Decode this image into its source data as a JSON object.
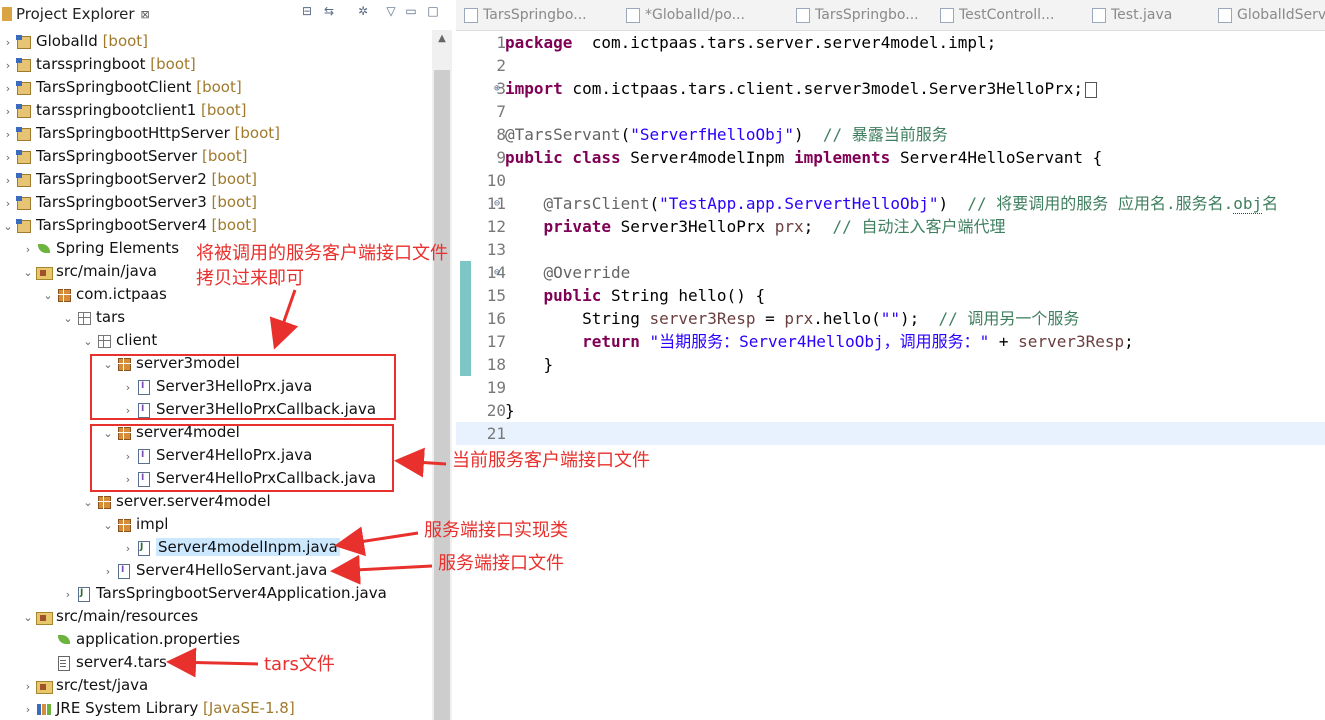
{
  "explorer": {
    "title": "Project Explorer",
    "close_glyph": "⊠",
    "tree": [
      {
        "level": 0,
        "twisty": ">",
        "icon": "project-icon",
        "label": "GlobalId",
        "meta": "[boot]"
      },
      {
        "level": 0,
        "twisty": ">",
        "icon": "project-icon",
        "label": "tarsspringboot",
        "meta": "[boot]"
      },
      {
        "level": 0,
        "twisty": ">",
        "icon": "project-icon",
        "label": "TarsSpringbootClient",
        "meta": "[boot]"
      },
      {
        "level": 0,
        "twisty": ">",
        "icon": "project-icon",
        "label": "tarsspringbootclient1",
        "meta": "[boot]"
      },
      {
        "level": 0,
        "twisty": ">",
        "icon": "project-icon",
        "label": "TarsSpringbootHttpServer",
        "meta": "[boot]"
      },
      {
        "level": 0,
        "twisty": ">",
        "icon": "project-icon",
        "label": "TarsSpringbootServer",
        "meta": "[boot]"
      },
      {
        "level": 0,
        "twisty": ">",
        "icon": "project-icon",
        "label": "TarsSpringbootServer2",
        "meta": "[boot]"
      },
      {
        "level": 0,
        "twisty": ">",
        "icon": "project-icon",
        "label": "TarsSpringbootServer3",
        "meta": "[boot]"
      },
      {
        "level": 0,
        "twisty": "v",
        "icon": "project-icon",
        "label": "TarsSpringbootServer4",
        "meta": "[boot]"
      },
      {
        "level": 1,
        "twisty": ">",
        "icon": "spring-leaf-icon",
        "label": "Spring Elements",
        "meta": ""
      },
      {
        "level": 1,
        "twisty": "v",
        "icon": "source-folder-icon",
        "label": "src/main/java",
        "meta": ""
      },
      {
        "level": 2,
        "twisty": "v",
        "icon": "package-icon",
        "label": "com.ictpaas",
        "meta": ""
      },
      {
        "level": 3,
        "twisty": "v",
        "icon": "package-empty-icon",
        "label": "tars",
        "meta": ""
      },
      {
        "level": 4,
        "twisty": "v",
        "icon": "package-empty-icon",
        "label": "client",
        "meta": ""
      },
      {
        "level": 5,
        "twisty": "v",
        "icon": "package-icon",
        "label": "server3model",
        "meta": ""
      },
      {
        "level": 6,
        "twisty": ">",
        "icon": "java-interface-icon",
        "label": "Server3HelloPrx.java",
        "meta": ""
      },
      {
        "level": 6,
        "twisty": ">",
        "icon": "java-interface-icon",
        "label": "Server3HelloPrxCallback.java",
        "meta": ""
      },
      {
        "level": 5,
        "twisty": "v",
        "icon": "package-icon",
        "label": "server4model",
        "meta": ""
      },
      {
        "level": 6,
        "twisty": ">",
        "icon": "java-interface-icon",
        "label": "Server4HelloPrx.java",
        "meta": ""
      },
      {
        "level": 6,
        "twisty": ">",
        "icon": "java-interface-icon",
        "label": "Server4HelloPrxCallback.java",
        "meta": ""
      },
      {
        "level": 4,
        "twisty": "v",
        "icon": "package-icon",
        "label": "server.server4model",
        "meta": ""
      },
      {
        "level": 5,
        "twisty": "v",
        "icon": "package-icon",
        "label": "impl",
        "meta": ""
      },
      {
        "level": 6,
        "twisty": ">",
        "icon": "java-class-icon",
        "label": "Server4modelInpm.java",
        "meta": "",
        "selected": true
      },
      {
        "level": 5,
        "twisty": ">",
        "icon": "java-interface-icon",
        "label": "Server4HelloServant.java",
        "meta": ""
      },
      {
        "level": 3,
        "twisty": ">",
        "icon": "java-class-icon",
        "label": "TarsSpringbootServer4Application.java",
        "meta": ""
      },
      {
        "level": 1,
        "twisty": "v",
        "icon": "source-folder-icon",
        "label": "src/main/resources",
        "meta": ""
      },
      {
        "level": 2,
        "twisty": "",
        "icon": "spring-leaf-icon",
        "label": "application.properties",
        "meta": ""
      },
      {
        "level": 2,
        "twisty": "",
        "icon": "text-file-icon",
        "label": "server4.tars",
        "meta": ""
      },
      {
        "level": 1,
        "twisty": ">",
        "icon": "source-folder-icon",
        "label": "src/test/java",
        "meta": ""
      },
      {
        "level": 1,
        "twisty": ">",
        "icon": "library-icon",
        "label": "JRE System Library",
        "meta": "[JavaSE-1.8]"
      }
    ]
  },
  "editor": {
    "tabs": [
      {
        "label": "TarsSpringbo..."
      },
      {
        "label": "*GlobalId/po..."
      },
      {
        "label": "TarsSpringbo..."
      },
      {
        "label": "TestControll..."
      },
      {
        "label": "Test.java"
      },
      {
        "label": "GlobalIdServ..."
      }
    ],
    "lines": [
      {
        "num": "1",
        "fold": "",
        "tokens": [
          [
            "kw",
            "package"
          ],
          [
            "",
            "  com.ictpaas.tars.server.server4model.impl;"
          ]
        ]
      },
      {
        "num": "2",
        "fold": "",
        "tokens": []
      },
      {
        "num": "3",
        "fold": "⊕",
        "tokens": [
          [
            "kw",
            "import"
          ],
          [
            "",
            " com.ictpaas.tars.client.server3model.Server3HelloPrx;"
          ],
          [
            "box",
            "□"
          ]
        ]
      },
      {
        "num": "7",
        "fold": "",
        "tokens": []
      },
      {
        "num": "8",
        "fold": "",
        "tokens": [
          [
            "ann",
            "@TarsServant"
          ],
          [
            "",
            "("
          ],
          [
            "str",
            "\"ServerfHelloObj\""
          ],
          [
            "",
            ")  "
          ],
          [
            "cmt",
            "// 暴露当前服务"
          ]
        ]
      },
      {
        "num": "9",
        "fold": "",
        "tokens": [
          [
            "kw",
            "public class"
          ],
          [
            "",
            " Server4modelInpm "
          ],
          [
            "kw",
            "implements"
          ],
          [
            "",
            " Server4HelloServant {"
          ]
        ]
      },
      {
        "num": "10",
        "fold": "",
        "tokens": []
      },
      {
        "num": "11",
        "fold": "⊖",
        "tokens": [
          [
            "",
            "    "
          ],
          [
            "ann",
            "@TarsClient"
          ],
          [
            "",
            "("
          ],
          [
            "str",
            "\"TestApp.app.ServertHelloObj\""
          ],
          [
            "",
            ")  "
          ],
          [
            "cmt",
            "// 将要调用的服务 应用名.服务名."
          ],
          [
            "cmtsq",
            "obj"
          ],
          [
            "cmt",
            "名"
          ]
        ]
      },
      {
        "num": "12",
        "fold": "",
        "tokens": [
          [
            "",
            "    "
          ],
          [
            "kw",
            "private"
          ],
          [
            "",
            " Server3HelloPrx "
          ],
          [
            "var",
            "prx"
          ],
          [
            "",
            ";  "
          ],
          [
            "cmt",
            "// 自动注入客户端代理"
          ]
        ]
      },
      {
        "num": "13",
        "fold": "",
        "tokens": []
      },
      {
        "num": "14",
        "fold": "⊖",
        "tokens": [
          [
            "",
            "    "
          ],
          [
            "ann",
            "@Override"
          ]
        ]
      },
      {
        "num": "15",
        "fold": "",
        "tokens": [
          [
            "",
            "    "
          ],
          [
            "kw",
            "public"
          ],
          [
            "",
            " String hello() {"
          ]
        ]
      },
      {
        "num": "16",
        "fold": "",
        "tokens": [
          [
            "",
            "        String "
          ],
          [
            "var",
            "server3Resp"
          ],
          [
            "",
            " = "
          ],
          [
            "var",
            "prx"
          ],
          [
            "",
            ".hello("
          ],
          [
            "str",
            "\"\""
          ],
          [
            "",
            ");  "
          ],
          [
            "cmt",
            "// 调用另一个服务"
          ]
        ]
      },
      {
        "num": "17",
        "fold": "",
        "tokens": [
          [
            "",
            "        "
          ],
          [
            "kw",
            "return"
          ],
          [
            "",
            " "
          ],
          [
            "str",
            "\"当期服务：Server4HelloObj，调用服务：\""
          ],
          [
            "",
            " + "
          ],
          [
            "var",
            "server3Resp"
          ],
          [
            "",
            ";"
          ]
        ]
      },
      {
        "num": "18",
        "fold": "",
        "tokens": [
          [
            "",
            "    }"
          ]
        ]
      },
      {
        "num": "19",
        "fold": "",
        "tokens": []
      },
      {
        "num": "20",
        "fold": "",
        "tokens": [
          [
            "",
            "}"
          ]
        ]
      },
      {
        "num": "21",
        "fold": "",
        "tokens": []
      }
    ]
  },
  "annotations": {
    "copy_note_line1": "将被调用的服务客户端接口文件",
    "copy_note_line2": "拷贝过来即可",
    "current_client_note": "当前服务客户端接口文件",
    "impl_note": "服务端接口实现类",
    "servant_note": "服务端接口文件",
    "tars_note": "tars文件"
  },
  "colors": {
    "annotation_red": "#e8302d",
    "selection_blue": "#cce8ff",
    "keyword": "#7f0055",
    "string": "#2a00ff",
    "comment": "#3f7f5f"
  }
}
